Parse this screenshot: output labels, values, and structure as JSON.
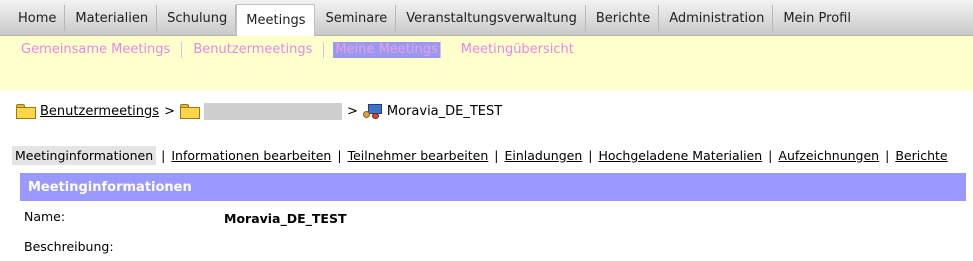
{
  "topnav": {
    "tabs": [
      {
        "label": "Home"
      },
      {
        "label": "Materialien"
      },
      {
        "label": "Schulung"
      },
      {
        "label": "Meetings"
      },
      {
        "label": "Seminare"
      },
      {
        "label": "Veranstaltungsverwaltung"
      },
      {
        "label": "Berichte"
      },
      {
        "label": "Administration"
      },
      {
        "label": "Mein Profil"
      }
    ],
    "active": "Meetings"
  },
  "subnav": {
    "items": [
      {
        "label": "Gemeinsame Meetings"
      },
      {
        "label": "Benutzermeetings"
      },
      {
        "label": "Meine Meetings"
      },
      {
        "label": "Meetingübersicht"
      }
    ],
    "current": "Meine Meetings"
  },
  "breadcrumb": {
    "root": "Benutzermeetings",
    "separator": ">",
    "current": "Moravia_DE_TEST"
  },
  "meeting_tabs": {
    "items": [
      {
        "label": "Meetinginformationen"
      },
      {
        "label": "Informationen bearbeiten"
      },
      {
        "label": "Teilnehmer bearbeiten"
      },
      {
        "label": "Einladungen"
      },
      {
        "label": "Hochgeladene Materialien"
      },
      {
        "label": "Aufzeichnungen"
      },
      {
        "label": "Berichte"
      }
    ],
    "active": "Meetinginformationen"
  },
  "section": {
    "title": "Meetinginformationen",
    "fields": {
      "name_label": "Name:",
      "name_value": "Moravia_DE_TEST",
      "description_label": "Beschreibung:"
    }
  },
  "colors": {
    "subnav_bg": "#ffffcc",
    "subnav_link": "#e48ae6",
    "section_header_bg": "#9999ff"
  }
}
